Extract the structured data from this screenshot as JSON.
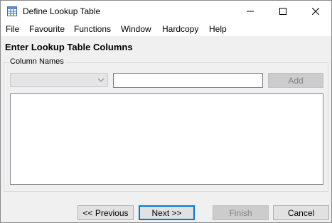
{
  "window": {
    "title": "Define Lookup Table",
    "icon": "table-icon",
    "controls": [
      "minimize-icon",
      "maximize-icon",
      "close-icon"
    ]
  },
  "menu": {
    "file": "File",
    "favourite": "Favourite",
    "functions": "Functions",
    "window": "Window",
    "hardcopy": "Hardcopy",
    "help": "Help"
  },
  "page": {
    "heading": "Enter Lookup Table Columns"
  },
  "column_names": {
    "group_label": "Column Names",
    "type_selected": "",
    "name_value": "",
    "add_label": "Add",
    "items": []
  },
  "wizard": {
    "previous_label": "<< Previous",
    "next_label": "Next >>",
    "finish_label": "Finish",
    "cancel_label": "Cancel"
  },
  "colors": {
    "focus_border": "#0078d7",
    "disabled_bg": "#cccccc"
  }
}
